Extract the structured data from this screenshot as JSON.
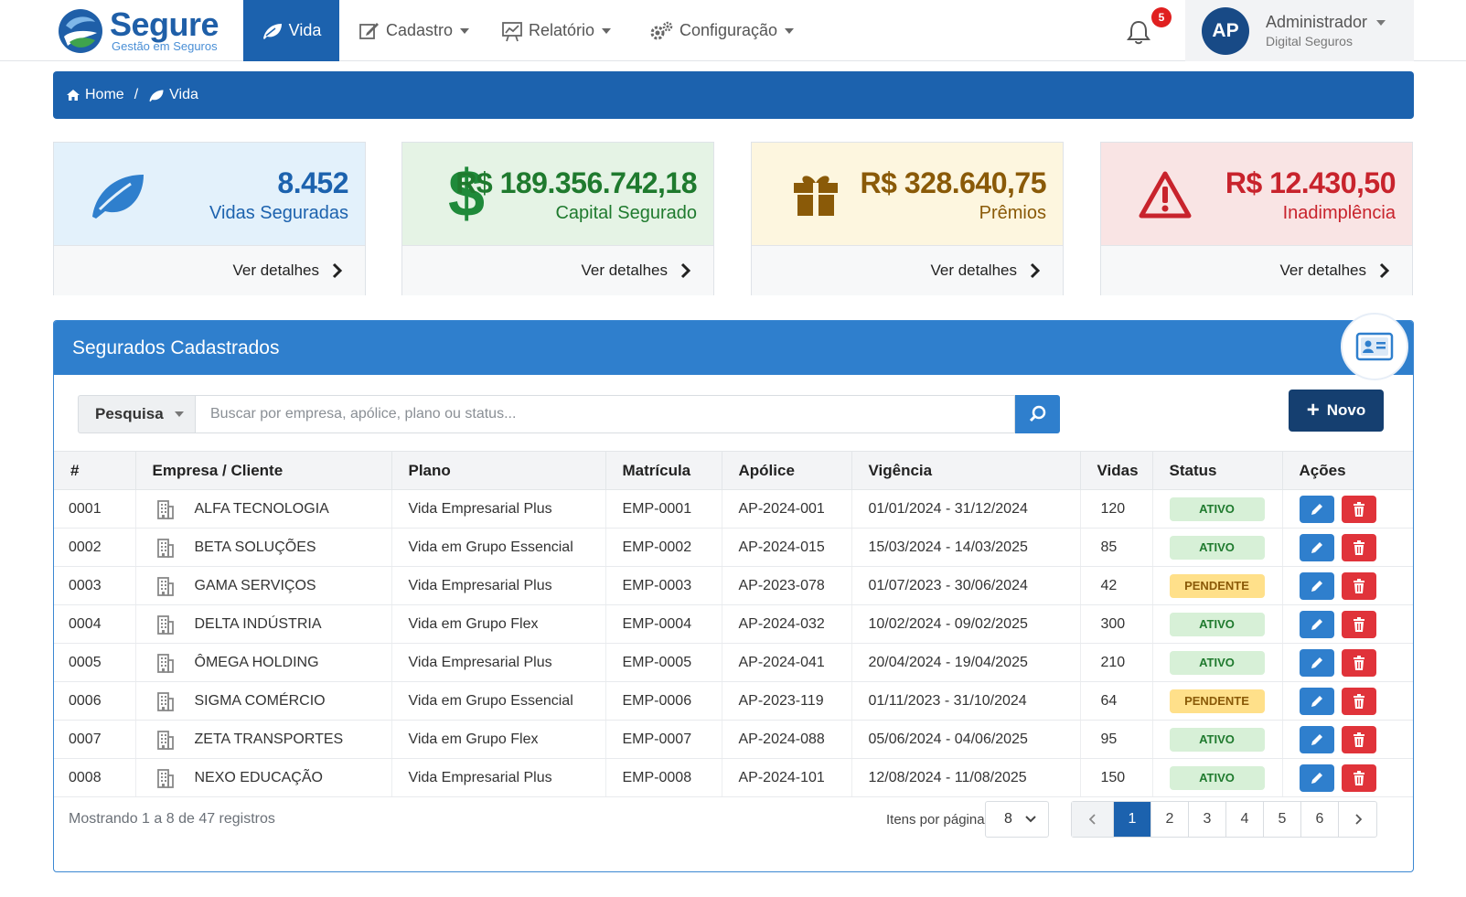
{
  "brand": {
    "name": "Segure",
    "tagline": "Gestão em Seguros"
  },
  "nav": {
    "items": [
      {
        "label": "Vida",
        "icon": "leaf-icon",
        "active": true
      },
      {
        "label": "Cadastro",
        "icon": "edit-icon"
      },
      {
        "label": "Relatório",
        "icon": "chart-icon"
      },
      {
        "label": "Configuração",
        "icon": "gears-icon"
      }
    ],
    "notifications": "5"
  },
  "user": {
    "initials": "AP",
    "name": "Administrador",
    "org": "Digital Seguros"
  },
  "breadcrumb": {
    "home": "Home",
    "current": "Vida"
  },
  "cards": [
    {
      "value": "8.452",
      "label": "Vidas Seguradas",
      "link": "Ver detalhes",
      "icon": "leaf-icon",
      "color": "#1c62ae"
    },
    {
      "value": "R$ 189.356.742,18",
      "label": "Capital Segurado",
      "link": "Ver detalhes",
      "icon": "dollar-icon",
      "color": "#1f7a2e"
    },
    {
      "value": "R$ 328.640,75",
      "label": "Prêmios",
      "link": "Ver detalhes",
      "icon": "gift-icon",
      "color": "#8a5a08"
    },
    {
      "value": "R$ 12.430,50",
      "label": "Inadimplência",
      "link": "Ver detalhes",
      "icon": "warning-icon",
      "color": "#c8232c"
    }
  ],
  "panel": {
    "title": "Segurados Cadastrados",
    "search": {
      "select": "Pesquisa",
      "placeholder": "Buscar por empresa, apólice, plano ou status..."
    },
    "new_label": "Novo",
    "columns": [
      "#",
      "Empresa / Cliente",
      "Plano",
      "Matrícula",
      "Apólice",
      "Vigência",
      "Vidas",
      "Status",
      "Ações"
    ],
    "rows": [
      {
        "id": "0001",
        "empresa": "ALFA TECNOLOGIA",
        "plano": "Vida Empresarial Plus",
        "matricula": "EMP-0001",
        "apolice": "AP-2024-001",
        "vigencia": "01/01/2024 - 31/12/2024",
        "vidas": "120",
        "status": "ATIVO"
      },
      {
        "id": "0002",
        "empresa": "BETA SOLUÇÕES",
        "plano": "Vida em Grupo Essencial",
        "matricula": "EMP-0002",
        "apolice": "AP-2024-015",
        "vigencia": "15/03/2024 - 14/03/2025",
        "vidas": "85",
        "status": "ATIVO"
      },
      {
        "id": "0003",
        "empresa": "GAMA SERVIÇOS",
        "plano": "Vida Empresarial Plus",
        "matricula": "EMP-0003",
        "apolice": "AP-2023-078",
        "vigencia": "01/07/2023 - 30/06/2024",
        "vidas": "42",
        "status": "PENDENTE"
      },
      {
        "id": "0004",
        "empresa": "DELTA INDÚSTRIA",
        "plano": "Vida em Grupo Flex",
        "matricula": "EMP-0004",
        "apolice": "AP-2024-032",
        "vigencia": "10/02/2024 - 09/02/2025",
        "vidas": "300",
        "status": "ATIVO"
      },
      {
        "id": "0005",
        "empresa": "ÔMEGA HOLDING",
        "plano": "Vida Empresarial Plus",
        "matricula": "EMP-0005",
        "apolice": "AP-2024-041",
        "vigencia": "20/04/2024 - 19/04/2025",
        "vidas": "210",
        "status": "ATIVO"
      },
      {
        "id": "0006",
        "empresa": "SIGMA COMÉRCIO",
        "plano": "Vida em Grupo Essencial",
        "matricula": "EMP-0006",
        "apolice": "AP-2023-119",
        "vigencia": "01/11/2023 - 31/10/2024",
        "vidas": "64",
        "status": "PENDENTE"
      },
      {
        "id": "0007",
        "empresa": "ZETA TRANSPORTES",
        "plano": "Vida em Grupo Flex",
        "matricula": "EMP-0007",
        "apolice": "AP-2024-088",
        "vigencia": "05/06/2024 - 04/06/2025",
        "vidas": "95",
        "status": "ATIVO"
      },
      {
        "id": "0008",
        "empresa": "NEXO EDUCAÇÃO",
        "plano": "Vida Empresarial Plus",
        "matricula": "EMP-0008",
        "apolice": "AP-2024-101",
        "vigencia": "12/08/2024 - 11/08/2025",
        "vidas": "150",
        "status": "ATIVO"
      }
    ],
    "footer": {
      "info": "Mostrando 1 a 8 de 47 registros",
      "per_page_label": "Itens por página",
      "per_page": "8",
      "pages": [
        "1",
        "2",
        "3",
        "4",
        "5",
        "6"
      ],
      "current_page": "1"
    }
  }
}
